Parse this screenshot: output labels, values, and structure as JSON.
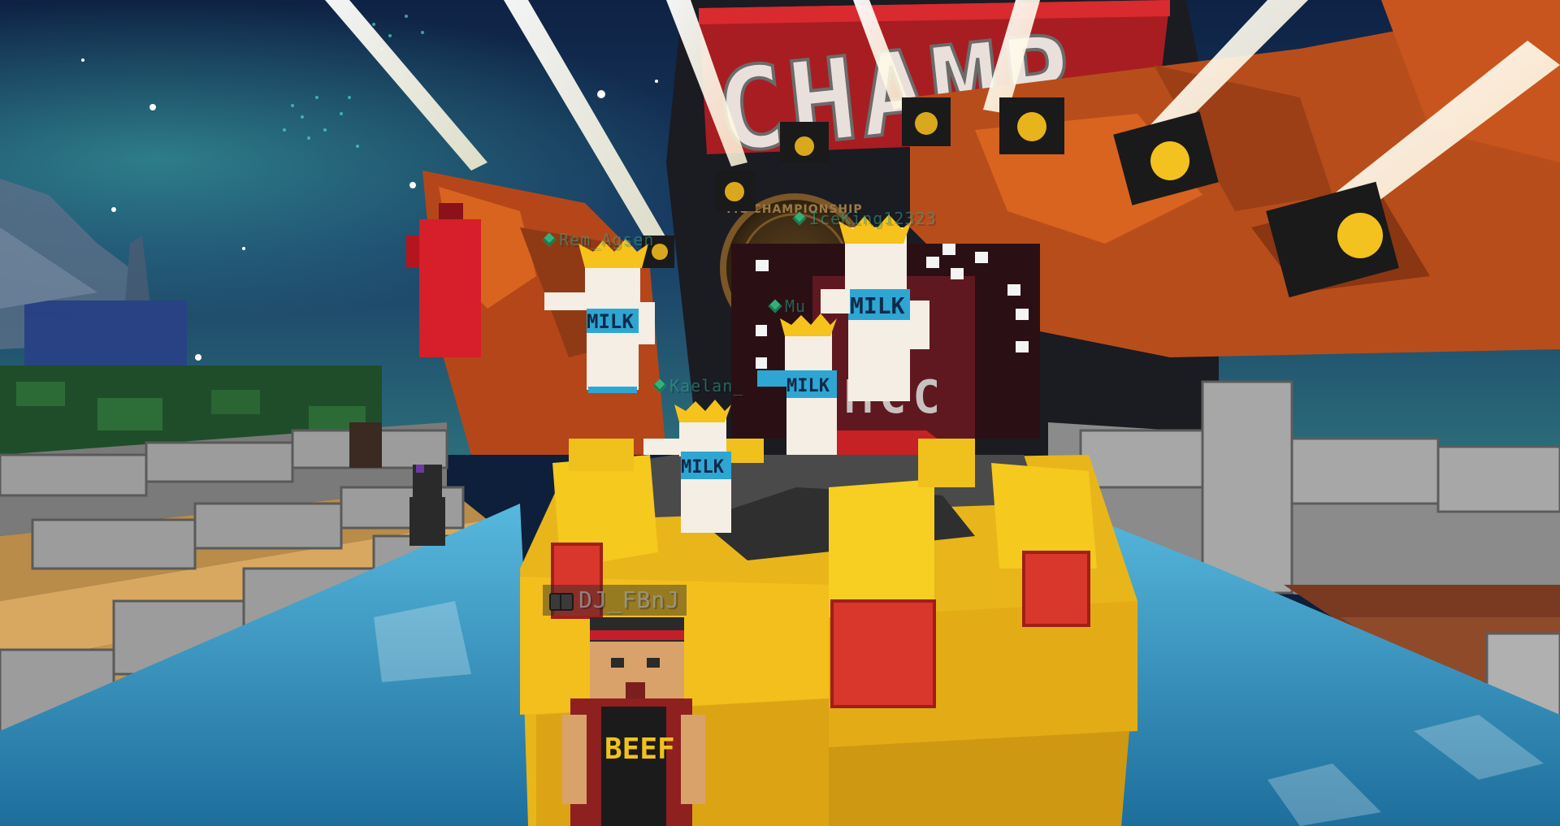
{
  "scene": {
    "setting": "night-sky-arena",
    "colors": {
      "sky": "#12294d",
      "podium_gold": "#f2c21d",
      "podium_red": "#d9362c",
      "building_orange": "#c4561f",
      "water": "#3fa7d6",
      "stone": "#8f8f8f"
    }
  },
  "signage": {
    "banner_text": "CHAMP",
    "medal_text": "MC CHAMPIONSHIP",
    "doorway_letters": "MCC",
    "shirt_text": "MILK",
    "player_shirt_text": "BEEF"
  },
  "nametags": [
    {
      "id": "tag-1",
      "name": "Rem_Agsen",
      "icon": "gem-icon"
    },
    {
      "id": "tag-2",
      "name": "IceKing12323",
      "icon": "gem-icon"
    },
    {
      "id": "tag-3",
      "name": "Mu",
      "icon": "gem-icon"
    },
    {
      "id": "tag-4",
      "name": "Kaelan_",
      "icon": "gem-icon"
    }
  ],
  "player_nametag": {
    "name": "DJ_FBnJ",
    "icon": "binoculars-icon"
  }
}
